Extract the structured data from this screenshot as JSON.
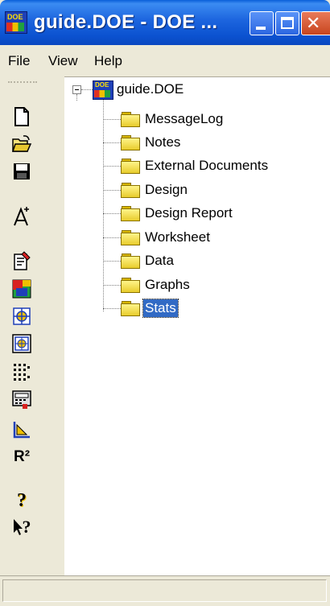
{
  "window": {
    "title": "guide.DOE - DOE ...",
    "icon": "doe-app-icon",
    "icon_text": "DOE"
  },
  "menubar": {
    "items": [
      {
        "label": "File"
      },
      {
        "label": "View"
      },
      {
        "label": "Help"
      }
    ]
  },
  "toolbar": {
    "buttons": [
      {
        "icon": "new-document-icon"
      },
      {
        "icon": "open-folder-icon"
      },
      {
        "icon": "save-icon"
      },
      {
        "icon": "wizard-icon"
      },
      {
        "icon": "edit-design-icon"
      },
      {
        "icon": "design-table-icon"
      },
      {
        "icon": "analyze-icon"
      },
      {
        "icon": "model-icon"
      },
      {
        "icon": "data-grid-icon"
      },
      {
        "icon": "calculator-icon"
      },
      {
        "icon": "graph-icon"
      },
      {
        "icon": "r-squared-icon",
        "label": "R²"
      },
      {
        "icon": "help-icon",
        "label": "?"
      },
      {
        "icon": "context-help-icon",
        "label": "?"
      }
    ]
  },
  "tree": {
    "root": {
      "label": "guide.DOE",
      "icon": "doe-file-icon",
      "expanded": true
    },
    "children": [
      {
        "label": "MessageLog",
        "icon": "folder-icon"
      },
      {
        "label": "Notes",
        "icon": "folder-icon"
      },
      {
        "label": "External Documents",
        "icon": "folder-icon"
      },
      {
        "label": "Design",
        "icon": "folder-icon"
      },
      {
        "label": "Design Report",
        "icon": "folder-icon"
      },
      {
        "label": "Worksheet",
        "icon": "folder-icon"
      },
      {
        "label": "Data",
        "icon": "folder-icon"
      },
      {
        "label": "Graphs",
        "icon": "folder-icon"
      },
      {
        "label": "Stats",
        "icon": "folder-icon",
        "selected": true
      }
    ]
  },
  "colors": {
    "titlebar": "#0B52D0",
    "selection": "#316AC5",
    "chrome": "#ECE9D8"
  }
}
